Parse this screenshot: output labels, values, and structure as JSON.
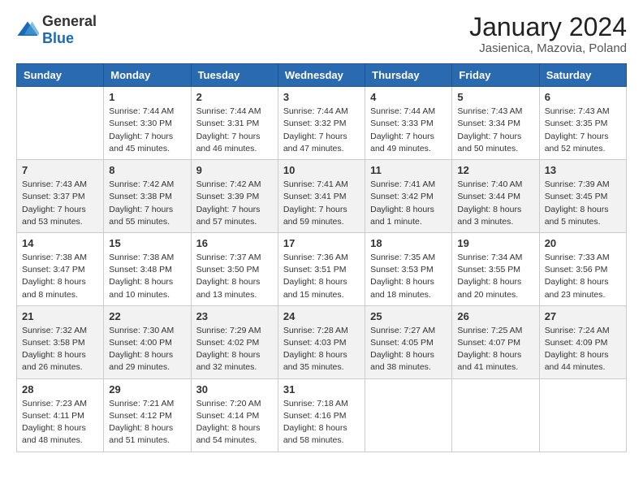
{
  "header": {
    "logo": {
      "general": "General",
      "blue": "Blue"
    },
    "title": "January 2024",
    "location": "Jasienica, Mazovia, Poland"
  },
  "days_of_week": [
    "Sunday",
    "Monday",
    "Tuesday",
    "Wednesday",
    "Thursday",
    "Friday",
    "Saturday"
  ],
  "weeks": [
    [
      {
        "day": null,
        "info": ""
      },
      {
        "day": "1",
        "sunrise": "7:44 AM",
        "sunset": "3:30 PM",
        "daylight": "7 hours and 45 minutes."
      },
      {
        "day": "2",
        "sunrise": "7:44 AM",
        "sunset": "3:31 PM",
        "daylight": "7 hours and 46 minutes."
      },
      {
        "day": "3",
        "sunrise": "7:44 AM",
        "sunset": "3:32 PM",
        "daylight": "7 hours and 47 minutes."
      },
      {
        "day": "4",
        "sunrise": "7:44 AM",
        "sunset": "3:33 PM",
        "daylight": "7 hours and 49 minutes."
      },
      {
        "day": "5",
        "sunrise": "7:43 AM",
        "sunset": "3:34 PM",
        "daylight": "7 hours and 50 minutes."
      },
      {
        "day": "6",
        "sunrise": "7:43 AM",
        "sunset": "3:35 PM",
        "daylight": "7 hours and 52 minutes."
      }
    ],
    [
      {
        "day": "7",
        "sunrise": "7:43 AM",
        "sunset": "3:37 PM",
        "daylight": "7 hours and 53 minutes."
      },
      {
        "day": "8",
        "sunrise": "7:42 AM",
        "sunset": "3:38 PM",
        "daylight": "7 hours and 55 minutes."
      },
      {
        "day": "9",
        "sunrise": "7:42 AM",
        "sunset": "3:39 PM",
        "daylight": "7 hours and 57 minutes."
      },
      {
        "day": "10",
        "sunrise": "7:41 AM",
        "sunset": "3:41 PM",
        "daylight": "7 hours and 59 minutes."
      },
      {
        "day": "11",
        "sunrise": "7:41 AM",
        "sunset": "3:42 PM",
        "daylight": "8 hours and 1 minute."
      },
      {
        "day": "12",
        "sunrise": "7:40 AM",
        "sunset": "3:44 PM",
        "daylight": "8 hours and 3 minutes."
      },
      {
        "day": "13",
        "sunrise": "7:39 AM",
        "sunset": "3:45 PM",
        "daylight": "8 hours and 5 minutes."
      }
    ],
    [
      {
        "day": "14",
        "sunrise": "7:38 AM",
        "sunset": "3:47 PM",
        "daylight": "8 hours and 8 minutes."
      },
      {
        "day": "15",
        "sunrise": "7:38 AM",
        "sunset": "3:48 PM",
        "daylight": "8 hours and 10 minutes."
      },
      {
        "day": "16",
        "sunrise": "7:37 AM",
        "sunset": "3:50 PM",
        "daylight": "8 hours and 13 minutes."
      },
      {
        "day": "17",
        "sunrise": "7:36 AM",
        "sunset": "3:51 PM",
        "daylight": "8 hours and 15 minutes."
      },
      {
        "day": "18",
        "sunrise": "7:35 AM",
        "sunset": "3:53 PM",
        "daylight": "8 hours and 18 minutes."
      },
      {
        "day": "19",
        "sunrise": "7:34 AM",
        "sunset": "3:55 PM",
        "daylight": "8 hours and 20 minutes."
      },
      {
        "day": "20",
        "sunrise": "7:33 AM",
        "sunset": "3:56 PM",
        "daylight": "8 hours and 23 minutes."
      }
    ],
    [
      {
        "day": "21",
        "sunrise": "7:32 AM",
        "sunset": "3:58 PM",
        "daylight": "8 hours and 26 minutes."
      },
      {
        "day": "22",
        "sunrise": "7:30 AM",
        "sunset": "4:00 PM",
        "daylight": "8 hours and 29 minutes."
      },
      {
        "day": "23",
        "sunrise": "7:29 AM",
        "sunset": "4:02 PM",
        "daylight": "8 hours and 32 minutes."
      },
      {
        "day": "24",
        "sunrise": "7:28 AM",
        "sunset": "4:03 PM",
        "daylight": "8 hours and 35 minutes."
      },
      {
        "day": "25",
        "sunrise": "7:27 AM",
        "sunset": "4:05 PM",
        "daylight": "8 hours and 38 minutes."
      },
      {
        "day": "26",
        "sunrise": "7:25 AM",
        "sunset": "4:07 PM",
        "daylight": "8 hours and 41 minutes."
      },
      {
        "day": "27",
        "sunrise": "7:24 AM",
        "sunset": "4:09 PM",
        "daylight": "8 hours and 44 minutes."
      }
    ],
    [
      {
        "day": "28",
        "sunrise": "7:23 AM",
        "sunset": "4:11 PM",
        "daylight": "8 hours and 48 minutes."
      },
      {
        "day": "29",
        "sunrise": "7:21 AM",
        "sunset": "4:12 PM",
        "daylight": "8 hours and 51 minutes."
      },
      {
        "day": "30",
        "sunrise": "7:20 AM",
        "sunset": "4:14 PM",
        "daylight": "8 hours and 54 minutes."
      },
      {
        "day": "31",
        "sunrise": "7:18 AM",
        "sunset": "4:16 PM",
        "daylight": "8 hours and 58 minutes."
      },
      {
        "day": null,
        "info": ""
      },
      {
        "day": null,
        "info": ""
      },
      {
        "day": null,
        "info": ""
      }
    ]
  ],
  "labels": {
    "sunrise": "Sunrise:",
    "sunset": "Sunset:",
    "daylight": "Daylight:"
  }
}
